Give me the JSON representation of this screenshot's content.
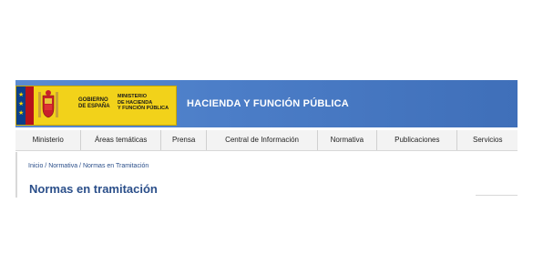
{
  "header": {
    "gobierno_text": "GOBIERNO\nDE ESPAÑA",
    "ministerio_text": "MINISTERIO\nDE HACIENDA\nY FUNCIÓN PÚBLICA",
    "ministry_title": "HACIENDA Y FUNCIÓN PÚBLICA",
    "colors": {
      "banner": "#4c7ec8",
      "logo_bg": "#f2d21a",
      "flag_blue": "#0b3f8a",
      "flag_red": "#b5121b"
    }
  },
  "nav": {
    "items": [
      {
        "label": "Ministerio"
      },
      {
        "label": "Áreas temáticas"
      },
      {
        "label": "Prensa"
      },
      {
        "label": "Central de Información"
      },
      {
        "label": "Normativa"
      },
      {
        "label": "Publicaciones"
      },
      {
        "label": "Servicios"
      }
    ]
  },
  "breadcrumb": {
    "home": "Inicio",
    "section": "Normativa",
    "current": "Normas en Tramitación",
    "separator": " / "
  },
  "page": {
    "title": "Normas en tramitación",
    "title_color": "#2b4f8a"
  }
}
